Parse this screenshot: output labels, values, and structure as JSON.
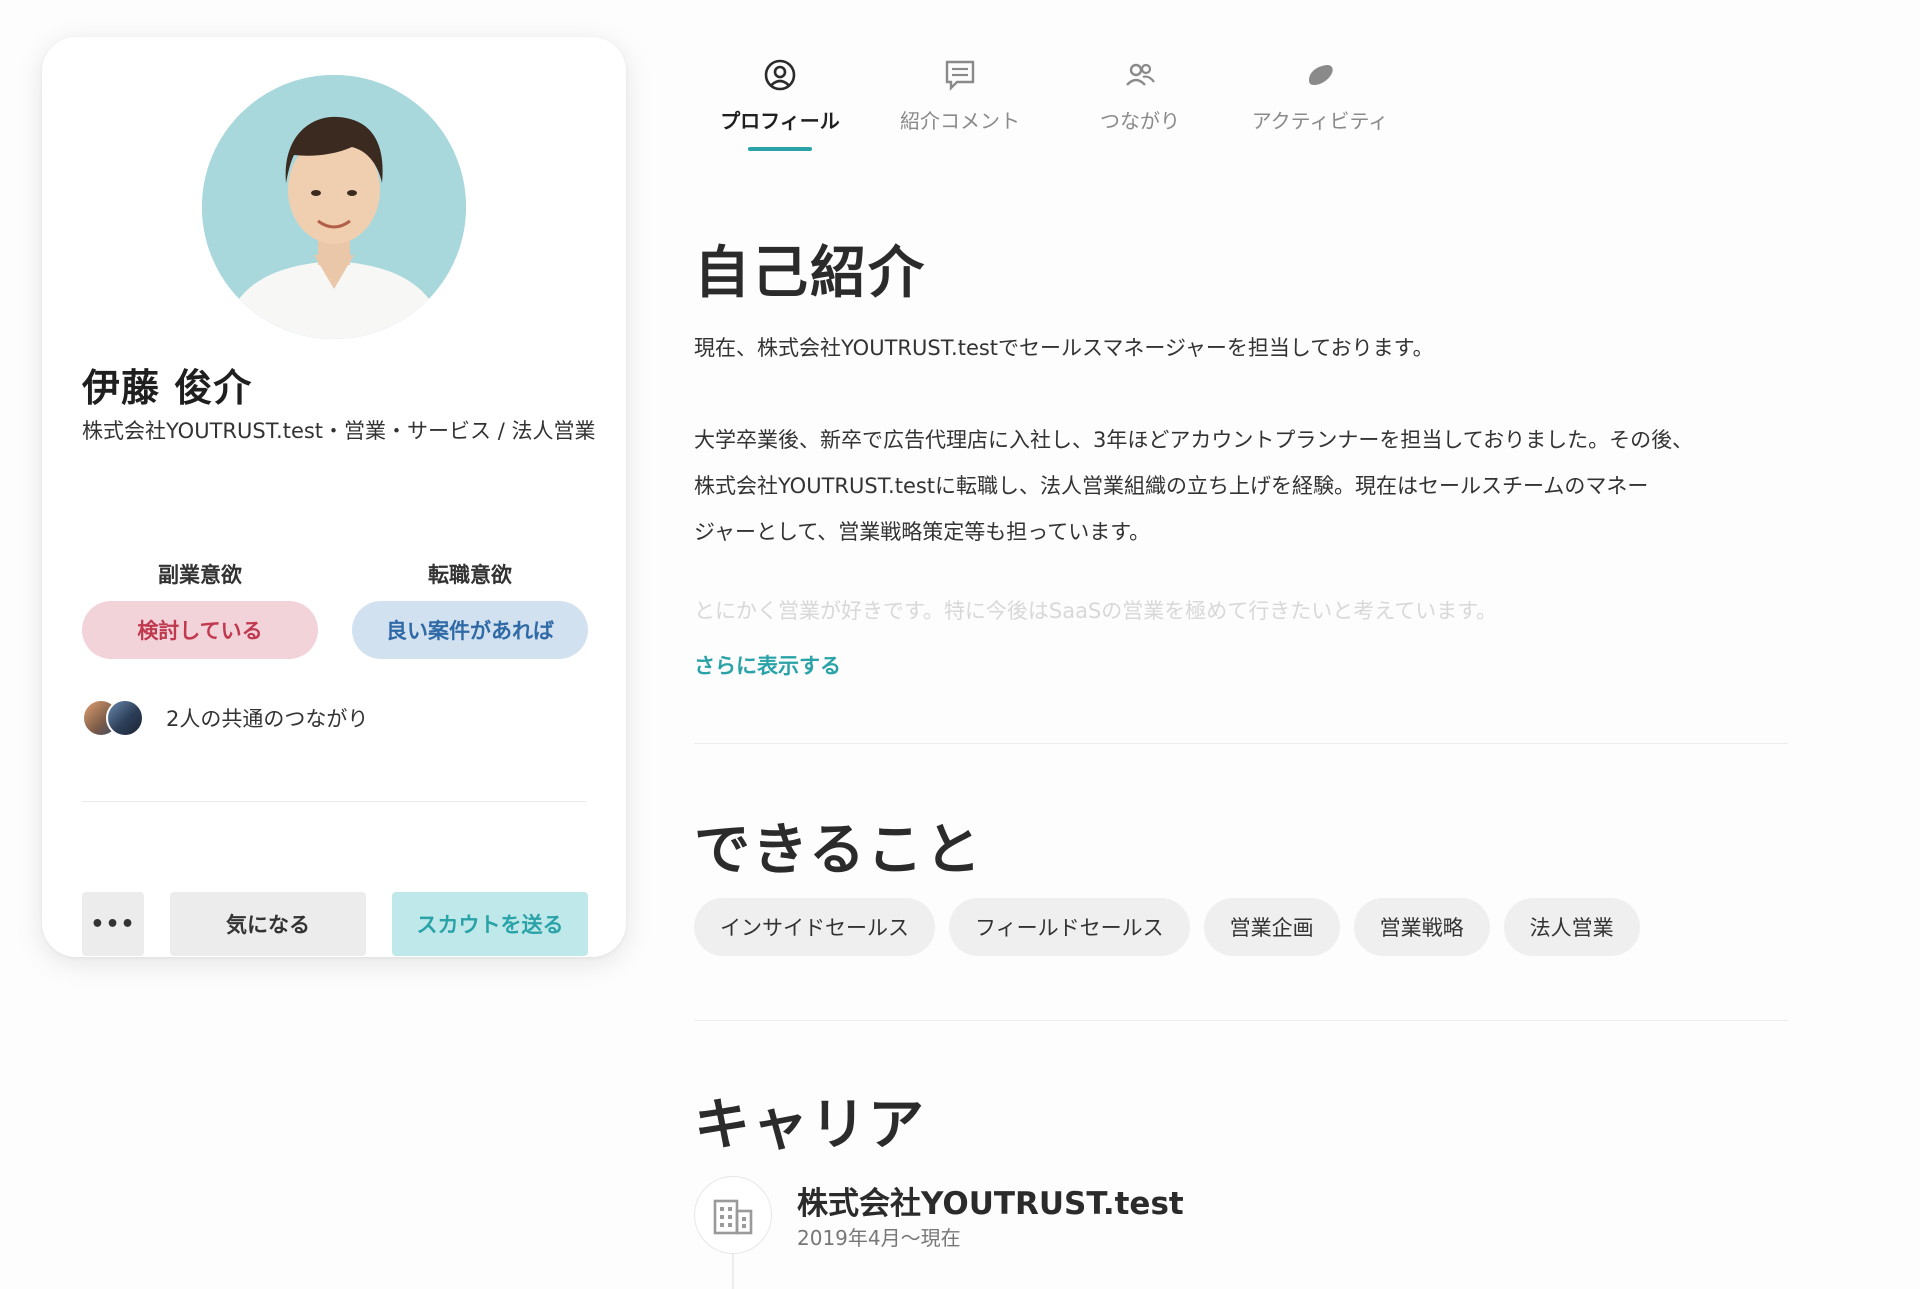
{
  "profile": {
    "name": "伊藤 俊介",
    "headline": "株式会社YOUTRUST.test・営業・サービス / 法人営業",
    "side_job_label": "副業意欲",
    "side_job_value": "検討している",
    "job_change_label": "転職意欲",
    "job_change_value": "良い案件があれば",
    "mutual_connections": "2人の共通のつながり",
    "actions": {
      "more": "•••",
      "interested": "気になる",
      "scout": "スカウトを送る"
    }
  },
  "tabs": [
    {
      "label": "プロフィール",
      "icon": "profile-icon",
      "active": true
    },
    {
      "label": "紹介コメント",
      "icon": "comment-icon",
      "active": false
    },
    {
      "label": "つながり",
      "icon": "people-icon",
      "active": false
    },
    {
      "label": "アクティビティ",
      "icon": "activity-icon",
      "active": false
    }
  ],
  "about": {
    "title": "自己紹介",
    "line1": "現在、株式会社YOUTRUST.testでセールスマネージャーを担当しております。",
    "line2": "大学卒業後、新卒で広告代理店に入社し、3年ほどアカウントプランナーを担当しておりました。その後、",
    "line3": "株式会社YOUTRUST.testに転職し、法人営業組織の立ち上げを経験。現在はセールスチームのマネー",
    "line4": "ジャーとして、営業戦略策定等も担っています。",
    "line5_faded": "とにかく営業が好きです。特に今後はSaaSの営業を極めて行きたいと考えています。",
    "show_more": "さらに表示する"
  },
  "skills_section": {
    "title": "できること",
    "skills": [
      "インサイドセールス",
      "フィールドセールス",
      "営業企画",
      "営業戦略",
      "法人営業"
    ]
  },
  "career_section": {
    "title": "キャリア",
    "company": "株式会社YOUTRUST.test",
    "period": "2019年4月〜現在",
    "icon": "building-icon"
  },
  "colors": {
    "accent": "#2aa3a8",
    "side_job_pill_bg": "#f3d3da",
    "side_job_pill_text": "#c0394f",
    "job_change_pill_bg": "#d2e1f0",
    "job_change_pill_text": "#2f6aa6"
  }
}
